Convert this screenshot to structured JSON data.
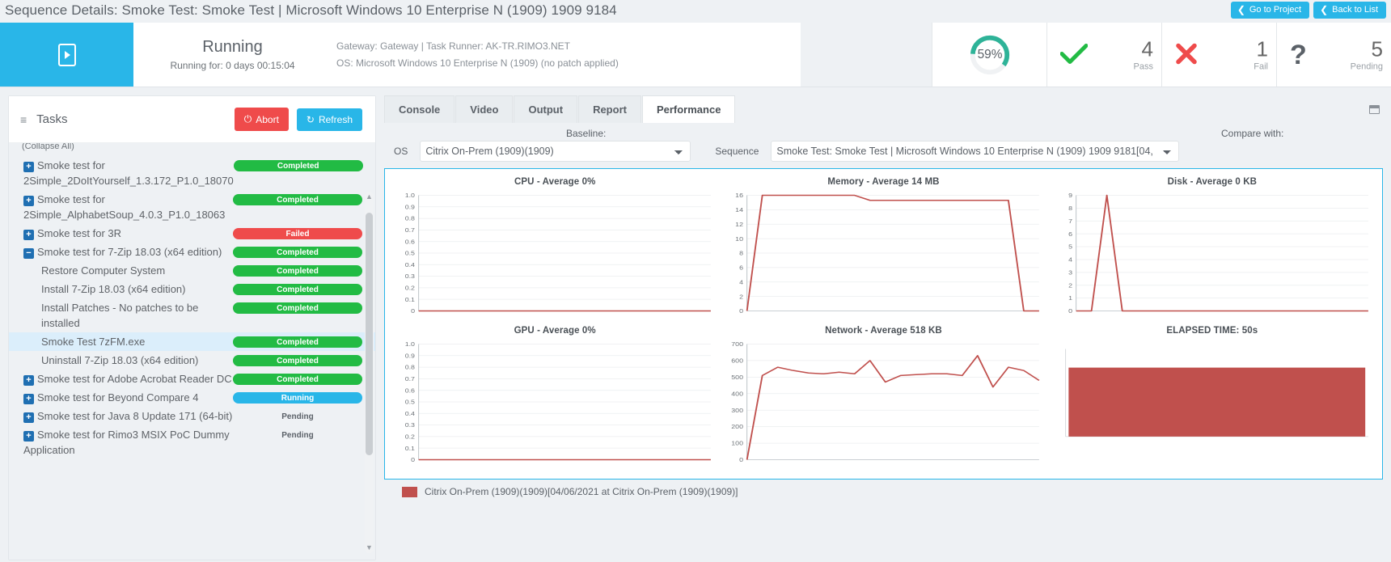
{
  "titlebar": {
    "title": "Sequence Details: Smoke Test: Smoke Test | Microsoft Windows 10 Enterprise N (1909) 1909 9184",
    "go_to_project": "Go to Project",
    "back_to_list": "Back to List",
    "chevron": "❮"
  },
  "status": {
    "state": "Running",
    "elapsed": "Running for: 0 days 00:15:04",
    "gateway_line": "Gateway: Gateway | Task Runner: AK-TR.RIMO3.NET",
    "os_line": "OS: Microsoft Windows 10 Enterprise N (1909) (no patch applied)",
    "progress_pct": "59%",
    "progress_value": 59,
    "metrics": [
      {
        "icon": "check-icon",
        "count": "4",
        "label": "Pass",
        "color": "#22bb44"
      },
      {
        "icon": "cross-icon",
        "count": "1",
        "label": "Fail",
        "color": "#ef4b4b"
      },
      {
        "icon": "question-icon",
        "count": "5",
        "label": "Pending",
        "color": "#5b6168"
      }
    ]
  },
  "tasks": {
    "header": "Tasks",
    "abort_label": "Abort",
    "refresh_label": "Refresh",
    "collapse_all": "(Collapse All)",
    "rows": [
      {
        "label": "Smoke test for 2Simple_2DoItYourself_1.3.172_P1.0_18070",
        "expander": "+",
        "status": "Completed",
        "kind": "completed",
        "level": 0
      },
      {
        "label": "Smoke test for 2Simple_AlphabetSoup_4.0.3_P1.0_18063",
        "expander": "+",
        "status": "Completed",
        "kind": "completed",
        "level": 0
      },
      {
        "label": "Smoke test for 3R",
        "expander": "+",
        "status": "Failed",
        "kind": "failed",
        "level": 0
      },
      {
        "label": "Smoke test for 7-Zip 18.03 (x64 edition)",
        "expander": "−",
        "status": "Completed",
        "kind": "completed",
        "level": 0
      },
      {
        "label": "Restore Computer System",
        "expander": "",
        "status": "Completed",
        "kind": "completed",
        "level": 1
      },
      {
        "label": "Install 7-Zip 18.03 (x64 edition)",
        "expander": "",
        "status": "Completed",
        "kind": "completed",
        "level": 1
      },
      {
        "label": "Install Patches - No patches to be installed",
        "expander": "",
        "status": "Completed",
        "kind": "completed",
        "level": 1
      },
      {
        "label": "Smoke Test 7zFM.exe",
        "expander": "",
        "status": "Completed",
        "kind": "completed",
        "level": 1,
        "selected": true
      },
      {
        "label": "Uninstall 7-Zip 18.03 (x64 edition)",
        "expander": "",
        "status": "Completed",
        "kind": "completed",
        "level": 1
      },
      {
        "label": "Smoke test for Adobe Acrobat Reader DC",
        "expander": "+",
        "status": "Completed",
        "kind": "completed",
        "level": 0
      },
      {
        "label": "Smoke test for Beyond Compare 4",
        "expander": "+",
        "status": "Running",
        "kind": "running",
        "level": 0
      },
      {
        "label": "Smoke test for Java 8 Update 171 (64-bit)",
        "expander": "+",
        "status": "Pending",
        "kind": "pending",
        "level": 0
      },
      {
        "label": "Smoke test for Rimo3 MSIX PoC Dummy Application",
        "expander": "+",
        "status": "Pending",
        "kind": "pending",
        "level": 0
      }
    ]
  },
  "main": {
    "tabs": [
      {
        "label": "Console",
        "active": false
      },
      {
        "label": "Video",
        "active": false
      },
      {
        "label": "Output",
        "active": false
      },
      {
        "label": "Report",
        "active": false
      },
      {
        "label": "Performance",
        "active": true
      }
    ],
    "baseline_caption": "Baseline:",
    "compare_caption": "Compare with:",
    "os_label": "OS",
    "os_value": "Citrix On-Prem (1909)(1909)",
    "sequence_label": "Sequence",
    "sequence_value": "Smoke Test: Smoke Test | Microsoft Windows 10 Enterprise N (1909) 1909 9181[04,",
    "legend_text": "Citrix On-Prem (1909)(1909)[04/06/2021 at Citrix On-Prem (1909)(1909)]",
    "legend_color": "#c0504d"
  },
  "chart_data": [
    {
      "type": "line",
      "title": "CPU - Average 0%",
      "xlabel": "",
      "ylabel": "",
      "ylim": [
        0,
        1.0
      ],
      "yticks": [
        "0",
        "0.1",
        "0.2",
        "0.3",
        "0.4",
        "0.5",
        "0.6",
        "0.7",
        "0.8",
        "0.9",
        "1.0"
      ],
      "series": [
        {
          "name": "Citrix On-Prem (1909)(1909)",
          "color": "#c0504d",
          "values": [
            0,
            0,
            0,
            0,
            0,
            0,
            0,
            0,
            0,
            0,
            0,
            0,
            0,
            0,
            0,
            0,
            0,
            0,
            0,
            0
          ]
        }
      ],
      "grid": true,
      "legend": "bottom"
    },
    {
      "type": "line",
      "title": "Memory - Average 14 MB",
      "xlabel": "",
      "ylabel": "",
      "ylim": [
        0,
        16
      ],
      "yticks": [
        "0",
        "2",
        "4",
        "6",
        "8",
        "10",
        "12",
        "14",
        "16"
      ],
      "series": [
        {
          "name": "Citrix On-Prem (1909)(1909)",
          "color": "#c0504d",
          "values": [
            0,
            16,
            16,
            16,
            16,
            16,
            16,
            16,
            15.3,
            15.3,
            15.3,
            15.3,
            15.3,
            15.3,
            15.3,
            15.3,
            15.3,
            15.3,
            0,
            0
          ]
        }
      ],
      "grid": true,
      "legend": "bottom"
    },
    {
      "type": "line",
      "title": "Disk - Average 0 KB",
      "xlabel": "",
      "ylabel": "",
      "ylim": [
        0,
        9
      ],
      "yticks": [
        "0",
        "1",
        "2",
        "3",
        "4",
        "5",
        "6",
        "7",
        "8",
        "9"
      ],
      "series": [
        {
          "name": "Citrix On-Prem (1909)(1909)",
          "color": "#c0504d",
          "values": [
            0,
            0,
            9,
            0,
            0,
            0,
            0,
            0,
            0,
            0,
            0,
            0,
            0,
            0,
            0,
            0,
            0,
            0,
            0,
            0
          ]
        }
      ],
      "grid": true,
      "legend": "bottom"
    },
    {
      "type": "line",
      "title": "GPU - Average 0%",
      "xlabel": "",
      "ylabel": "",
      "ylim": [
        0,
        1.0
      ],
      "yticks": [
        "0",
        "0.1",
        "0.2",
        "0.3",
        "0.4",
        "0.5",
        "0.6",
        "0.7",
        "0.8",
        "0.9",
        "1.0"
      ],
      "series": [
        {
          "name": "Citrix On-Prem (1909)(1909)",
          "color": "#c0504d",
          "values": [
            0,
            0,
            0,
            0,
            0,
            0,
            0,
            0,
            0,
            0,
            0,
            0,
            0,
            0,
            0,
            0,
            0,
            0,
            0,
            0
          ]
        }
      ],
      "grid": true,
      "legend": "bottom"
    },
    {
      "type": "line",
      "title": "Network - Average 518 KB",
      "xlabel": "",
      "ylabel": "",
      "ylim": [
        0,
        700
      ],
      "yticks": [
        "0",
        "100",
        "200",
        "300",
        "400",
        "500",
        "600",
        "700"
      ],
      "series": [
        {
          "name": "Citrix On-Prem (1909)(1909)",
          "color": "#c0504d",
          "values": [
            0,
            510,
            560,
            540,
            525,
            520,
            530,
            520,
            600,
            470,
            510,
            515,
            520,
            520,
            510,
            630,
            440,
            560,
            540,
            480
          ]
        }
      ],
      "grid": true,
      "legend": "bottom"
    },
    {
      "type": "bar",
      "title": "ELAPSED TIME: 50s",
      "categories": [
        "Citrix On-Prem (1909)(1909)"
      ],
      "values": [
        50
      ],
      "xlabel": "",
      "ylabel": "",
      "ylim": [
        0,
        60
      ],
      "grid": false,
      "legend": "none"
    }
  ]
}
